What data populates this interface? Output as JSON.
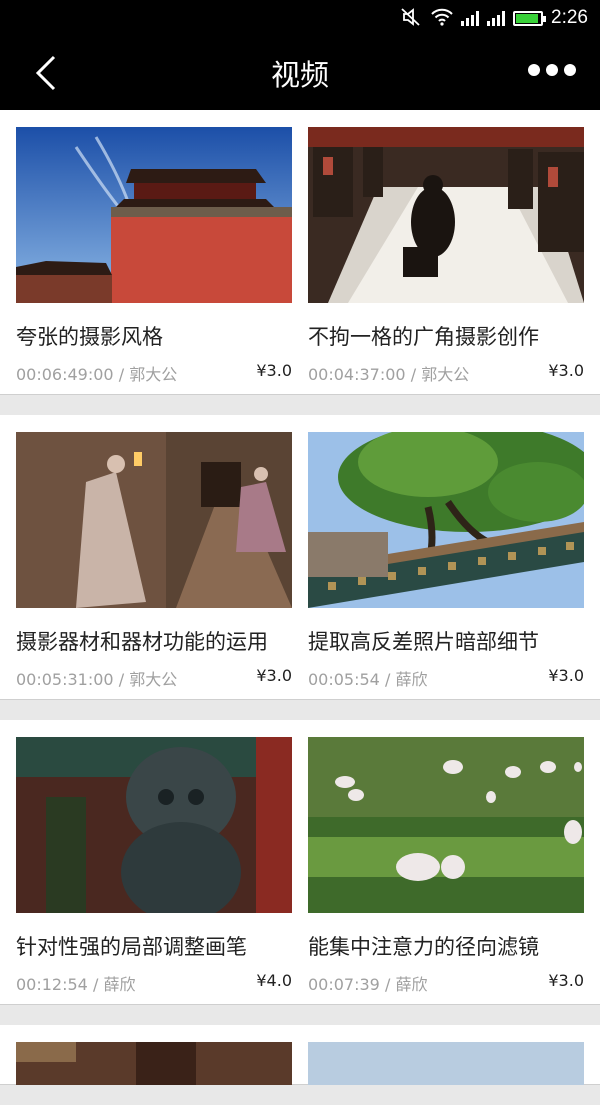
{
  "status": {
    "time": "2:26",
    "battery_level": 0.85,
    "icons": [
      "mute-icon",
      "wifi-icon",
      "signal-icon",
      "signal-icon",
      "battery-icon"
    ]
  },
  "header": {
    "title": "视频",
    "back_icon": "chevron-left-icon",
    "more_icon": "more-icon"
  },
  "videos": [
    {
      "title": "夸张的摄影风格",
      "duration": "00:06:49:00",
      "sep": "/",
      "author": "郭大公",
      "price": "¥3.0"
    },
    {
      "title": "不拘一格的广角摄影创作",
      "duration": "00:04:37:00",
      "sep": "/",
      "author": "郭大公",
      "price": "¥3.0"
    },
    {
      "title": "摄影器材和器材功能的运用",
      "duration": "00:05:31:00",
      "sep": "/",
      "author": "郭大公",
      "price": "¥3.0"
    },
    {
      "title": "提取高反差照片暗部细节",
      "duration": "00:05:54",
      "sep": "/",
      "author": "薛欣",
      "price": "¥3.0"
    },
    {
      "title": "针对性强的局部调整画笔",
      "duration": "00:12:54",
      "sep": "/",
      "author": "薛欣",
      "price": "¥4.0"
    },
    {
      "title": "能集中注意力的径向滤镜",
      "duration": "00:07:39",
      "sep": "/",
      "author": "薛欣",
      "price": "¥3.0"
    }
  ]
}
